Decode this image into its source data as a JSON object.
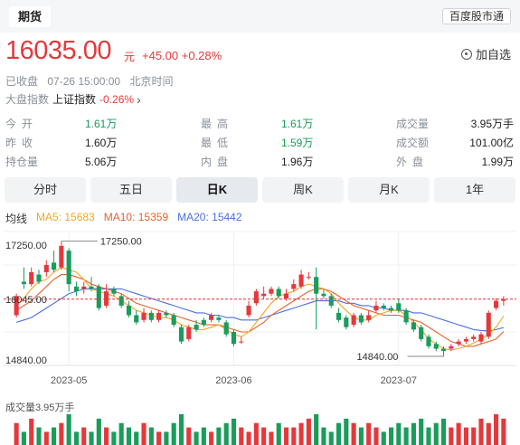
{
  "header": {
    "tab_label": "期货",
    "brand_label": "百度股市通"
  },
  "quote": {
    "price": "16035.00",
    "unit": "元",
    "change": "+45.00",
    "change_pct": "+0.28%",
    "follow_label": "加自选"
  },
  "status": {
    "state": "已收盘",
    "time": "07-26 15:00:00",
    "zone": "北京时间"
  },
  "index": {
    "label": "大盘指数",
    "name": "上证指数",
    "value": "-0.26%"
  },
  "stats": [
    {
      "label": "今开",
      "value": "1.61万",
      "color": "#1a9c5b"
    },
    {
      "label": "最高",
      "value": "1.61万",
      "color": "#1a9c5b"
    },
    {
      "label": "成交量",
      "value": "3.95万手",
      "color": "#222222"
    },
    {
      "label": "昨收",
      "value": "1.60万",
      "color": "#222222"
    },
    {
      "label": "最低",
      "value": "1.59万",
      "color": "#1a9c5b"
    },
    {
      "label": "成交额",
      "value": "101.00亿",
      "color": "#222222"
    },
    {
      "label": "持仓量",
      "value": "5.06万",
      "color": "#222222"
    },
    {
      "label": "内盘",
      "value": "1.96万",
      "color": "#222222"
    },
    {
      "label": "外盘",
      "value": "1.99万",
      "color": "#222222"
    }
  ],
  "period_tabs": [
    "分时",
    "五日",
    "日K",
    "周K",
    "月K",
    "1年"
  ],
  "active_period": "日K",
  "ma": {
    "label": "均线",
    "ma5_label": "MA5: 15683",
    "ma10_label": "MA10: 15359",
    "ma20_label": "MA20: 15442"
  },
  "colors": {
    "up": "#e4393c",
    "down": "#1a9c5b",
    "ma5": "#f5a623",
    "ma10": "#e8612c",
    "ma20": "#4a6fe3"
  },
  "chart_data": {
    "type": "candlestick",
    "title": "",
    "x_ticks": [
      "2023-05",
      "2023-06",
      "2023-07"
    ],
    "price_axis": {
      "top_label": "17250.00",
      "bottom_label": "14840.00",
      "ylim": [
        14650,
        17450
      ]
    },
    "current_price": 16035,
    "current_price_label": "16045.00",
    "max_label": "17250.00",
    "min_label": "14840.00",
    "candles": [
      {
        "o": 15700,
        "c": 16100,
        "h": 16150,
        "l": 15650
      },
      {
        "o": 16400,
        "c": 16350,
        "h": 16700,
        "l": 16250
      },
      {
        "o": 16350,
        "c": 16600,
        "h": 16700,
        "l": 16300
      },
      {
        "o": 16550,
        "c": 16400,
        "h": 16650,
        "l": 16350
      },
      {
        "o": 16600,
        "c": 16750,
        "h": 16850,
        "l": 16500
      },
      {
        "o": 16800,
        "c": 16650,
        "h": 17050,
        "l": 16600
      },
      {
        "o": 16700,
        "c": 17150,
        "h": 17250,
        "l": 16650
      },
      {
        "o": 17050,
        "c": 16350,
        "h": 17100,
        "l": 16200
      },
      {
        "o": 16300,
        "c": 16200,
        "h": 16400,
        "l": 16100
      },
      {
        "o": 16250,
        "c": 16300,
        "h": 16400,
        "l": 16150
      },
      {
        "o": 16300,
        "c": 16250,
        "h": 16500,
        "l": 16200
      },
      {
        "o": 16300,
        "c": 15850,
        "h": 16350,
        "l": 15800
      },
      {
        "o": 15900,
        "c": 16200,
        "h": 16350,
        "l": 15850
      },
      {
        "o": 16250,
        "c": 16150,
        "h": 16300,
        "l": 16100
      },
      {
        "o": 16100,
        "c": 15900,
        "h": 16150,
        "l": 15850
      },
      {
        "o": 15900,
        "c": 15700,
        "h": 16000,
        "l": 15650
      },
      {
        "o": 15700,
        "c": 15550,
        "h": 15800,
        "l": 15500
      },
      {
        "o": 15600,
        "c": 15750,
        "h": 15850,
        "l": 15550
      },
      {
        "o": 15750,
        "c": 15600,
        "h": 15800,
        "l": 15550
      },
      {
        "o": 15600,
        "c": 15750,
        "h": 15800,
        "l": 15550
      },
      {
        "o": 15750,
        "c": 15700,
        "h": 15800,
        "l": 15650
      },
      {
        "o": 15700,
        "c": 15500,
        "h": 15750,
        "l": 15450
      },
      {
        "o": 15450,
        "c": 15150,
        "h": 15500,
        "l": 15100
      },
      {
        "o": 15200,
        "c": 15450,
        "h": 15500,
        "l": 15150
      },
      {
        "o": 15500,
        "c": 15400,
        "h": 15600,
        "l": 15350
      },
      {
        "o": 15600,
        "c": 15500,
        "h": 15650,
        "l": 15450
      },
      {
        "o": 15600,
        "c": 15700,
        "h": 15750,
        "l": 15550
      },
      {
        "o": 15650,
        "c": 15600,
        "h": 15700,
        "l": 15550
      },
      {
        "o": 15550,
        "c": 15300,
        "h": 15600,
        "l": 15250
      },
      {
        "o": 15350,
        "c": 15100,
        "h": 15400,
        "l": 15050
      },
      {
        "o": 15150,
        "c": 15150,
        "h": 15250,
        "l": 15100
      },
      {
        "o": 15700,
        "c": 15900,
        "h": 16000,
        "l": 15650
      },
      {
        "o": 15950,
        "c": 16200,
        "h": 16250,
        "l": 15900
      },
      {
        "o": 16100,
        "c": 16150,
        "h": 16300,
        "l": 16050
      },
      {
        "o": 16150,
        "c": 16250,
        "h": 16300,
        "l": 16100
      },
      {
        "o": 16250,
        "c": 16100,
        "h": 16300,
        "l": 16050
      },
      {
        "o": 16050,
        "c": 16150,
        "h": 16250,
        "l": 16000
      },
      {
        "o": 16250,
        "c": 16350,
        "h": 16450,
        "l": 16200
      },
      {
        "o": 16300,
        "c": 16550,
        "h": 16650,
        "l": 16250
      },
      {
        "o": 16500,
        "c": 16500,
        "h": 16600,
        "l": 16450
      },
      {
        "o": 16500,
        "c": 16150,
        "h": 16700,
        "l": 15400
      },
      {
        "o": 16150,
        "c": 16100,
        "h": 16250,
        "l": 16050
      },
      {
        "o": 16100,
        "c": 15900,
        "h": 16150,
        "l": 15850
      },
      {
        "o": 15750,
        "c": 15600,
        "h": 15850,
        "l": 15550
      },
      {
        "o": 15650,
        "c": 15450,
        "h": 15700,
        "l": 15400
      },
      {
        "o": 15500,
        "c": 15700,
        "h": 15750,
        "l": 15450
      },
      {
        "o": 15700,
        "c": 15550,
        "h": 15750,
        "l": 15500
      },
      {
        "o": 15600,
        "c": 15700,
        "h": 15800,
        "l": 15550
      },
      {
        "o": 15800,
        "c": 15900,
        "h": 16000,
        "l": 15750
      },
      {
        "o": 15900,
        "c": 15850,
        "h": 15950,
        "l": 15800
      },
      {
        "o": 15850,
        "c": 15800,
        "h": 15900,
        "l": 15750
      },
      {
        "o": 15950,
        "c": 15800,
        "h": 16050,
        "l": 15750
      },
      {
        "o": 15800,
        "c": 15550,
        "h": 15850,
        "l": 15500
      },
      {
        "o": 15550,
        "c": 15400,
        "h": 15600,
        "l": 15350
      },
      {
        "o": 15450,
        "c": 15200,
        "h": 15500,
        "l": 15150
      },
      {
        "o": 15250,
        "c": 15050,
        "h": 15300,
        "l": 15000
      },
      {
        "o": 15100,
        "c": 15000,
        "h": 15150,
        "l": 14950
      },
      {
        "o": 15000,
        "c": 14950,
        "h": 15050,
        "l": 14840
      },
      {
        "o": 15000,
        "c": 15050,
        "h": 15100,
        "l": 14950
      },
      {
        "o": 15100,
        "c": 15150,
        "h": 15200,
        "l": 15050
      },
      {
        "o": 15150,
        "c": 15200,
        "h": 15250,
        "l": 15100
      },
      {
        "o": 15200,
        "c": 15250,
        "h": 15300,
        "l": 15150
      },
      {
        "o": 15150,
        "c": 15300,
        "h": 15350,
        "l": 15100
      },
      {
        "o": 15250,
        "c": 15750,
        "h": 15800,
        "l": 15200
      },
      {
        "o": 15850,
        "c": 16000,
        "h": 16050,
        "l": 15800
      },
      {
        "o": 16000,
        "c": 16035,
        "h": 16100,
        "l": 15900
      }
    ],
    "ma5": [
      15900,
      16050,
      16250,
      16400,
      16450,
      16600,
      16700,
      16650,
      16600,
      16450,
      16250,
      16200,
      16150,
      16100,
      16000,
      15900,
      15800,
      15750,
      15700,
      15650,
      15650,
      15600,
      15500,
      15450,
      15400,
      15400,
      15450,
      15500,
      15400,
      15300,
      15250,
      15350,
      15550,
      15750,
      15950,
      16100,
      16150,
      16200,
      16300,
      16350,
      16300,
      16250,
      16150,
      15950,
      15800,
      15650,
      15600,
      15600,
      15700,
      15750,
      15800,
      15800,
      15700,
      15550,
      15400,
      15200,
      15100,
      15000,
      14970,
      15000,
      15050,
      15120,
      15200,
      15300,
      15450,
      15683
    ],
    "ma10": [
      15800,
      15900,
      16000,
      16150,
      16300,
      16450,
      16550,
      16550,
      16500,
      16450,
      16350,
      16300,
      16250,
      16200,
      16150,
      16050,
      15950,
      15900,
      15850,
      15800,
      15750,
      15700,
      15650,
      15600,
      15550,
      15500,
      15500,
      15500,
      15450,
      15400,
      15350,
      15350,
      15450,
      15550,
      15700,
      15800,
      15900,
      16000,
      16100,
      16200,
      16250,
      16250,
      16200,
      16100,
      16000,
      15900,
      15850,
      15800,
      15750,
      15700,
      15700,
      15700,
      15650,
      15600,
      15550,
      15450,
      15350,
      15250,
      15150,
      15100,
      15050,
      15050,
      15100,
      15150,
      15200,
      15359
    ],
    "ma20": [
      15550,
      15600,
      15650,
      15750,
      15850,
      15950,
      16050,
      16150,
      16200,
      16250,
      16250,
      16250,
      16250,
      16250,
      16250,
      16200,
      16150,
      16100,
      16050,
      16000,
      15950,
      15900,
      15850,
      15800,
      15750,
      15750,
      15700,
      15700,
      15650,
      15650,
      15600,
      15600,
      15600,
      15650,
      15700,
      15750,
      15800,
      15850,
      15900,
      15950,
      16000,
      16000,
      16000,
      16000,
      15950,
      15950,
      15900,
      15900,
      15850,
      15850,
      15800,
      15800,
      15800,
      15750,
      15750,
      15700,
      15650,
      15600,
      15550,
      15500,
      15450,
      15400,
      15380,
      15370,
      15400,
      15442
    ]
  },
  "volume": {
    "label": "成交量3.95万手",
    "values": [
      5,
      3,
      6,
      4,
      3,
      4,
      5,
      7,
      3,
      4,
      3,
      6,
      4,
      3,
      5,
      4,
      3,
      5,
      4,
      3,
      3,
      5,
      7,
      4,
      3,
      4,
      3,
      4,
      5,
      6,
      4,
      3,
      5,
      4,
      3,
      5,
      4,
      4,
      5,
      6,
      7,
      4,
      3,
      5,
      6,
      5,
      4,
      5,
      4,
      3,
      4,
      5,
      4,
      5,
      6,
      4,
      5,
      6,
      4,
      5,
      4,
      4,
      6,
      5,
      7,
      6
    ]
  }
}
